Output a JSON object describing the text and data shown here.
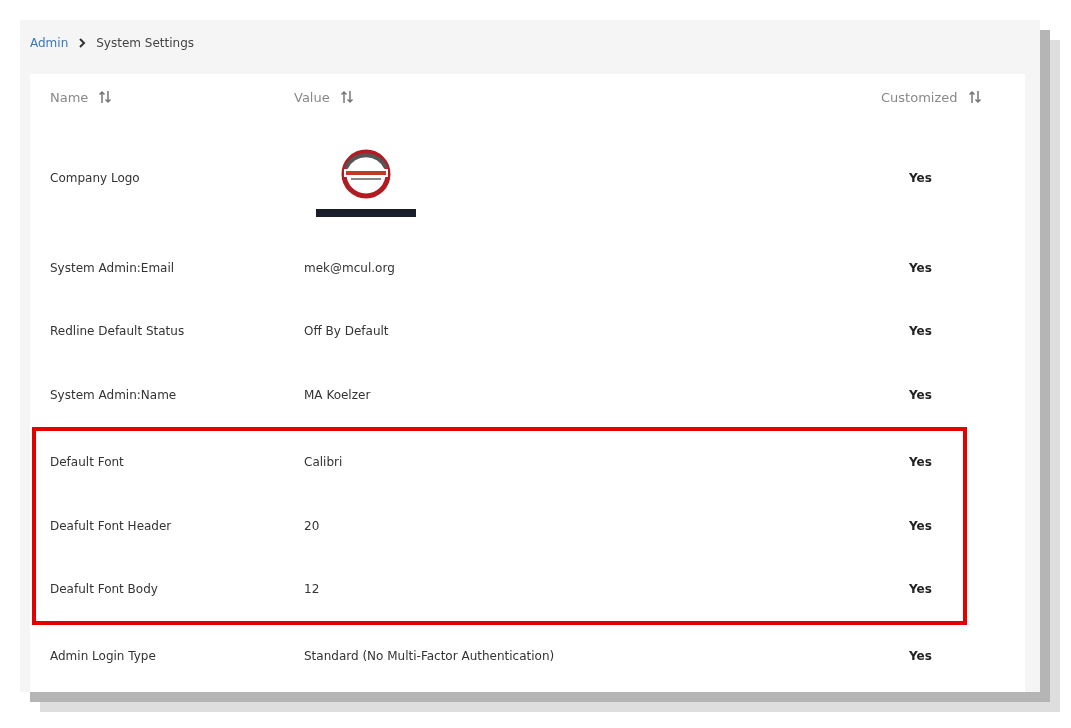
{
  "breadcrumb": [
    {
      "label": "Admin",
      "link": true
    },
    {
      "label": "System Settings",
      "link": false
    }
  ],
  "table": {
    "columns": [
      "Name",
      "Value",
      "Customized"
    ],
    "rows": [
      {
        "name": "Company Logo",
        "value": "",
        "customized": "Yes",
        "highlighted": false
      },
      {
        "name": "System Admin:Email",
        "kind": "text",
        "value": "mek@mcul.org",
        "customized": "Yes",
        "highlighted": false
      },
      {
        "name": "Redline Default Status",
        "kind": "text",
        "value": "Off By Default",
        "customized": "Yes",
        "highlighted": false
      },
      {
        "name": "System Admin:Name",
        "kind": "text",
        "value": "MA Koelzer",
        "customized": "Yes",
        "highlighted": false
      },
      {
        "name": "Default Font",
        "kind": "text",
        "value": "Calibri",
        "customized": "Yes",
        "highlighted": true
      },
      {
        "name": "Deafult Font Header",
        "kind": "text",
        "value": "20",
        "customized": "Yes",
        "highlighted": true
      },
      {
        "name": "Deafult Font Body",
        "kind": "text",
        "value": "12",
        "customized": "Yes",
        "highlighted": true
      },
      {
        "name": "Admin Login Type",
        "kind": "text",
        "value": "Standard (No Multi-Factor Authentication)",
        "customized": "Yes",
        "highlighted": false
      }
    ]
  }
}
